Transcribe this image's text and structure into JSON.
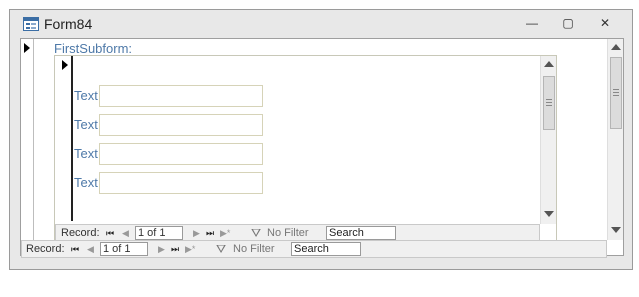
{
  "window": {
    "title": "Form84"
  },
  "window_buttons": {
    "minimize": "—",
    "restore": "▢",
    "close": "✕"
  },
  "form": {
    "subform_label": "FirstSubform:",
    "fields": [
      {
        "label": "Text",
        "value": ""
      },
      {
        "label": "Text",
        "value": ""
      },
      {
        "label": "Text",
        "value": ""
      },
      {
        "label": "Text",
        "value": ""
      }
    ]
  },
  "subform_nav": {
    "record_label": "Record:",
    "current": "1 of 1",
    "filter_label": "No Filter",
    "search_placeholder": "Search"
  },
  "main_nav": {
    "record_label": "Record:",
    "current": "1 of 1",
    "filter_label": "No Filter",
    "search_placeholder": "Search"
  },
  "icons": {
    "first": "⏮",
    "prev": "◀",
    "next": "▶",
    "last": "⏭",
    "new": "▶*",
    "filter": "⛛"
  }
}
